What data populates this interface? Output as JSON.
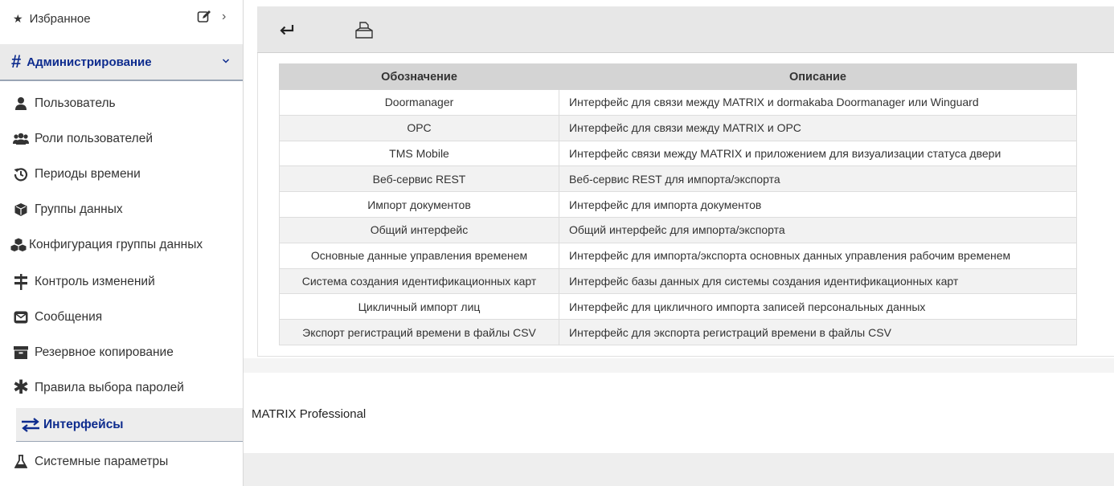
{
  "sidebar": {
    "favorites_label": "Избранное",
    "section_title": "Администрирование",
    "items": [
      {
        "label": "Пользователь",
        "icon": "user-icon"
      },
      {
        "label": "Роли пользователей",
        "icon": "users-icon"
      },
      {
        "label": "Периоды времени",
        "icon": "history-icon"
      },
      {
        "label": "Группы данных",
        "icon": "cube-icon"
      },
      {
        "label": "Конфигурация группы данных",
        "icon": "cubes-icon"
      },
      {
        "label": "Контроль изменений",
        "icon": "signpost-icon"
      },
      {
        "label": "Сообщения",
        "icon": "envelope-icon"
      },
      {
        "label": "Резервное копирование",
        "icon": "archive-icon"
      },
      {
        "label": "Правила выбора паролей",
        "icon": "asterisk-icon"
      },
      {
        "label": "Интерфейсы",
        "icon": "exchange-icon",
        "active": true
      },
      {
        "label": "Системные параметры",
        "icon": "flask-icon"
      }
    ]
  },
  "table": {
    "headers": [
      "Обозначение",
      "Описание"
    ],
    "rows": [
      [
        "Doormanager",
        "Интерфейс для связи между MATRIX и dormakaba Doormanager или Winguard"
      ],
      [
        "OPC",
        "Интерфейс для связи между MATRIX и OPC"
      ],
      [
        "TMS Mobile",
        "Интерфейс связи между MATRIX и приложением для визуализации статуса двери"
      ],
      [
        "Веб-сервис REST",
        "Веб-сервис REST для импорта/экспорта"
      ],
      [
        "Импорт документов",
        "Интерфейс для импорта документов"
      ],
      [
        "Общий интерфейс",
        "Общий интерфейс для импорта/экспорта"
      ],
      [
        "Основные данные управления временем",
        "Интерфейс для импорта/экспорта основных данных управления рабочим временем"
      ],
      [
        "Система создания идентификационных карт",
        "Интерфейс базы данных для системы создания идентификационных карт"
      ],
      [
        "Цикличный импорт лиц",
        "Интерфейс для цикличного импорта записей персональных данных"
      ],
      [
        "Экспорт регистраций времени в файлы CSV",
        "Интерфейс для экспорта регистраций времени в файлы CSV"
      ]
    ]
  },
  "footer": {
    "product": "MATRIX Professional"
  },
  "colors": {
    "accent": "#0e2c8e",
    "header_bg": "#d4d4d4",
    "toolbar_bg": "#e7e7e7"
  }
}
